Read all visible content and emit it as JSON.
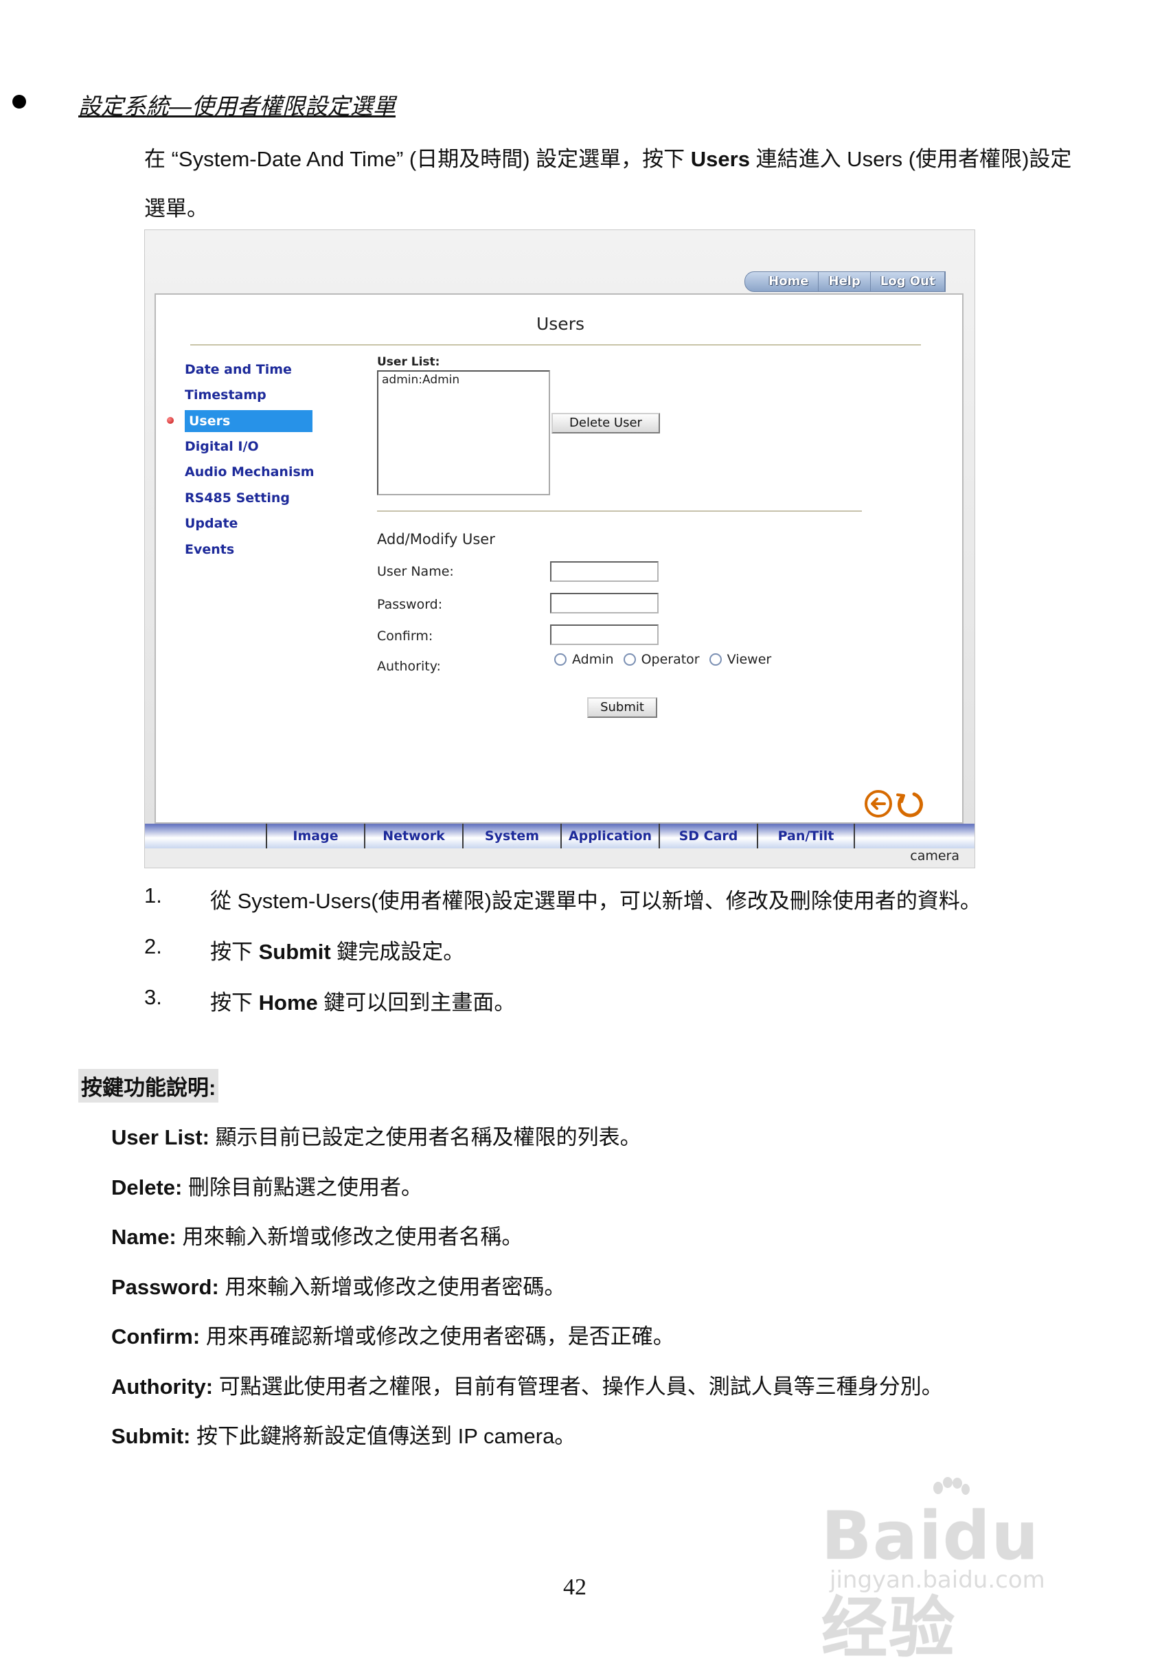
{
  "doc": {
    "heading_link": "設定系統—使用者權限設定選單",
    "intro_parts": [
      "在 “System-Date And Time” (日期及時間) 設定選單，按下 ",
      "Users",
      " 連結進入 Users (使用者權限)設定選單。"
    ],
    "steps": [
      {
        "num": "1.",
        "parts": [
          "從 System-Users(使用者權限)設定選單中，可以新增、修改及刪除使用者的資料。",
          "",
          ""
        ]
      },
      {
        "num": "2.",
        "parts": [
          "按下 ",
          "Submit",
          " 鍵完成設定。"
        ]
      },
      {
        "num": "3.",
        "parts": [
          "按下 ",
          "Home",
          " 鍵可以回到主畫面。"
        ]
      }
    ],
    "section_title": "按鍵功能說明:",
    "definitions": [
      {
        "term": "User List:",
        "desc": " 顯示目前已設定之使用者名稱及權限的列表。"
      },
      {
        "term": "Delete:",
        "desc": " 刪除目前點選之使用者。"
      },
      {
        "term": "Name:",
        "desc": " 用來輸入新增或修改之使用者名稱。"
      },
      {
        "term": "Password:",
        "desc": " 用來輸入新增或修改之使用者密碼。"
      },
      {
        "term": "Confirm:",
        "desc": " 用來再確認新增或修改之使用者密碼，是否正確。"
      },
      {
        "term": "Authority:",
        "desc": " 可點選此使用者之權限，目前有管理者、操作人員、測試人員等三種身分別。"
      },
      {
        "term": "Submit:",
        "desc": " 按下此鍵將新設定值傳送到 IP camera。"
      }
    ],
    "page_number": "42",
    "watermark": {
      "main": "Baidu经验",
      "sub": "jingyan.baidu.com"
    }
  },
  "camera_ui": {
    "topnav": [
      "Home",
      "Help",
      "Log Out"
    ],
    "title": "Users",
    "sidebar": [
      "Date and Time",
      "Timestamp",
      "Users",
      "Digital I/O",
      "Audio Mechanism",
      "RS485 Setting",
      "Update",
      "Events"
    ],
    "active_sidebar_index": 2,
    "user_list_label": "User List:",
    "user_list_items": [
      "admin:Admin"
    ],
    "delete_button": "Delete User",
    "add_modify_title": "Add/Modify User",
    "fields": {
      "user_name": "User Name:",
      "password": "Password:",
      "confirm": "Confirm:",
      "authority": "Authority:"
    },
    "field_values": {
      "user_name": "",
      "password": "",
      "confirm": ""
    },
    "authority_options": [
      "Admin",
      "Operator",
      "Viewer"
    ],
    "submit_button": "Submit",
    "bottom_tabs": [
      "Image",
      "Network",
      "System",
      "Application",
      "SD Card",
      "Pan/Tilt"
    ],
    "brand": "camera",
    "colors": {
      "link": "#1d2a9a",
      "active_bg": "#2792e8",
      "nav_icon": "#d66a00"
    }
  }
}
